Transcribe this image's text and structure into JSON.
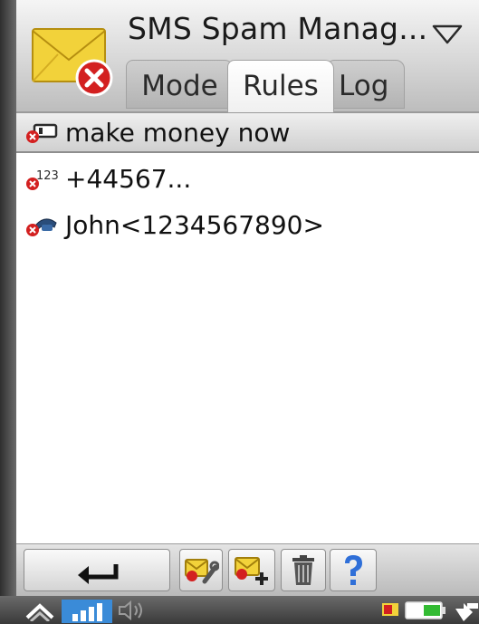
{
  "app": {
    "title": "SMS Spam Manag..."
  },
  "tabs": [
    {
      "label": "Mode",
      "selected": false
    },
    {
      "label": "Rules",
      "selected": true
    },
    {
      "label": "Log",
      "selected": false
    }
  ],
  "rules": [
    {
      "text": "make money now",
      "icon": "keyword-rule-icon",
      "selected": true
    },
    {
      "text": "+44567...",
      "icon": "number-rule-icon",
      "selected": false
    },
    {
      "text": "John<1234567890>",
      "icon": "contact-rule-icon",
      "selected": false
    }
  ],
  "toolbar": {
    "buttons": [
      "back-arrow-icon",
      "edit-rule-icon",
      "add-rule-icon",
      "trash-icon",
      "help-icon"
    ]
  },
  "statusbar": {
    "icons": [
      "chevron-up-icon",
      "signal-icon",
      "speaker-icon",
      "sim-icon",
      "battery-icon",
      "connection-icon"
    ]
  },
  "colors": {
    "envelope": "#f2d23a",
    "error_badge": "#d32020",
    "help": "#2f6fd8",
    "signal": "#3a8bd8",
    "battery": "#33bb33"
  }
}
